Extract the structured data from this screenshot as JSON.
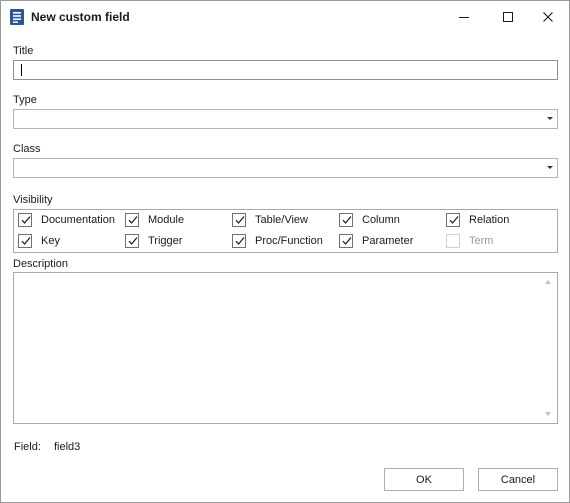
{
  "window": {
    "title": "New custom field",
    "controls": {
      "minimize": "minimize-icon",
      "maximize": "maximize-icon",
      "close": "close-icon"
    }
  },
  "form": {
    "title_label": "Title",
    "title_value": "",
    "type_label": "Type",
    "type_value": "",
    "class_label": "Class",
    "class_value": "",
    "visibility_label": "Visibility",
    "visibility": [
      {
        "label": "Documentation",
        "checked": true,
        "enabled": true
      },
      {
        "label": "Module",
        "checked": true,
        "enabled": true
      },
      {
        "label": "Table/View",
        "checked": true,
        "enabled": true
      },
      {
        "label": "Column",
        "checked": true,
        "enabled": true
      },
      {
        "label": "Relation",
        "checked": true,
        "enabled": true
      },
      {
        "label": "Key",
        "checked": true,
        "enabled": true
      },
      {
        "label": "Trigger",
        "checked": true,
        "enabled": true
      },
      {
        "label": "Proc/Function",
        "checked": true,
        "enabled": true
      },
      {
        "label": "Parameter",
        "checked": true,
        "enabled": true
      },
      {
        "label": "Term",
        "checked": false,
        "enabled": false
      }
    ],
    "description_label": "Description",
    "description_value": "",
    "field_label": "Field:",
    "field_value": "field3"
  },
  "buttons": {
    "ok": "OK",
    "cancel": "Cancel"
  },
  "colors": {
    "icon_blue": "#2b5797",
    "border": "#a9a9a9"
  }
}
